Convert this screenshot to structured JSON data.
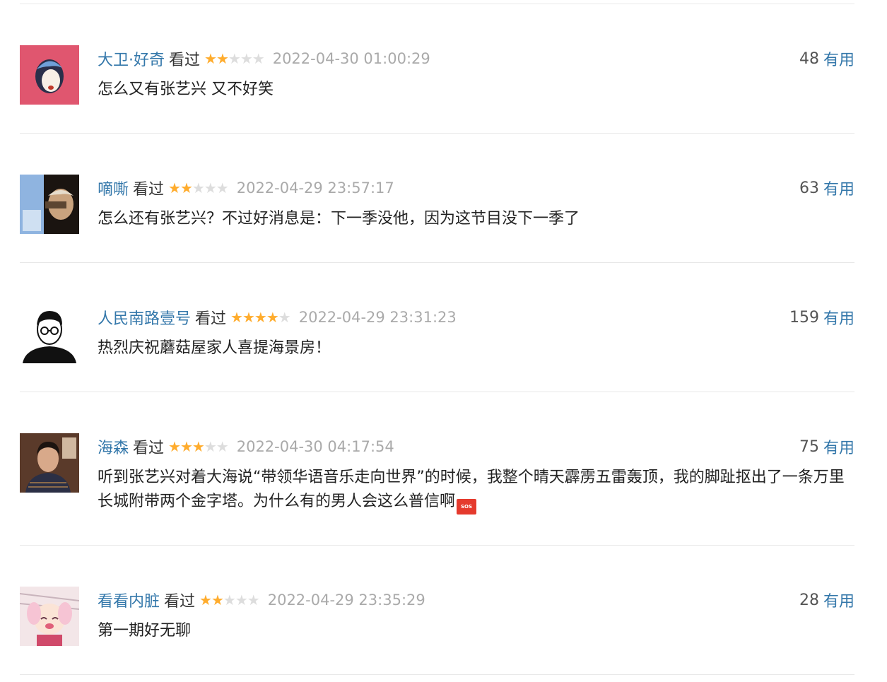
{
  "comments": [
    {
      "user": "大卫·好奇",
      "status": "看过",
      "rating": 2,
      "time": "2022-04-30 01:00:29",
      "votes": "48",
      "useful_label": "有用",
      "text": "怎么又有张艺兴 又不好笑"
    },
    {
      "user": "嘀嘶",
      "status": "看过",
      "rating": 2,
      "time": "2022-04-29 23:57:17",
      "votes": "63",
      "useful_label": "有用",
      "text": "怎么还有张艺兴？不过好消息是：下一季没他，因为这节目没下一季了"
    },
    {
      "user": "人民南路壹号",
      "status": "看过",
      "rating": 4,
      "time": "2022-04-29 23:31:23",
      "votes": "159",
      "useful_label": "有用",
      "text": "热烈庆祝蘑菇屋家人喜提海景房！"
    },
    {
      "user": "海森",
      "status": "看过",
      "rating": 3,
      "time": "2022-04-30 04:17:54",
      "votes": "75",
      "useful_label": "有用",
      "text": "听到张艺兴对着大海说“带领华语音乐走向世界”的时候，我整个晴天霹雳五雷轰顶，我的脚趾抠出了一条万里长城附带两个金字塔。为什么有的男人会这么普信啊",
      "emoji": "sos-emoji",
      "emoji_text": "SOS"
    },
    {
      "user": "看看内脏",
      "status": "看过",
      "rating": 2,
      "time": "2022-04-29 23:35:29",
      "votes": "28",
      "useful_label": "有用",
      "text": "第一期好无聊"
    }
  ],
  "colors": {
    "link": "#3377aa",
    "star_on": "#ffac2d",
    "star_off": "#dddddd",
    "time": "#aaaaaa"
  },
  "icons": {
    "star": "star-icon"
  }
}
